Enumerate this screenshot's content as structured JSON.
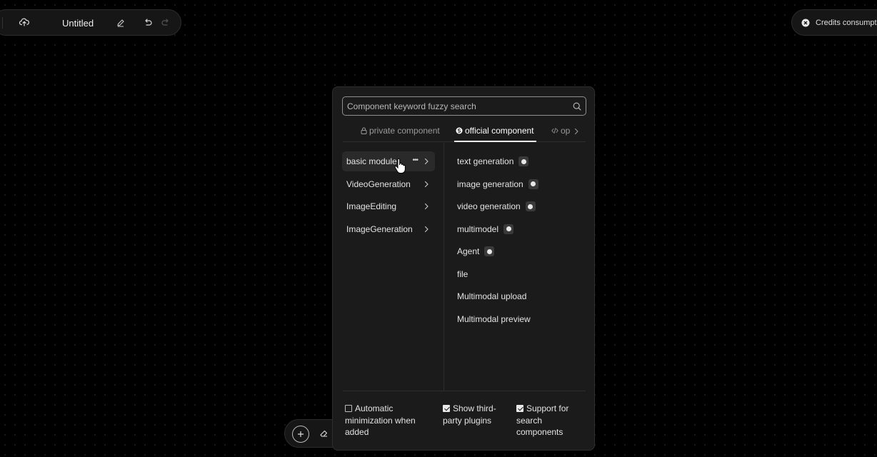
{
  "header": {
    "title": "Untitled",
    "credits_label": "Credits consumption"
  },
  "panel": {
    "search": {
      "placeholder": "Component keyword fuzzy search"
    },
    "tabs": [
      {
        "label": "private component",
        "icon": "lock-icon",
        "active": false
      },
      {
        "label": "official component",
        "icon": "official-badge-icon",
        "active": true
      },
      {
        "label": "op",
        "icon": "code-icon",
        "active": false
      }
    ],
    "categories": [
      {
        "label": "basic module",
        "active": true
      },
      {
        "label": "VideoGeneration",
        "active": false
      },
      {
        "label": "ImageEditing",
        "active": false
      },
      {
        "label": "ImageGeneration",
        "active": false
      }
    ],
    "components": [
      {
        "label": "text generation",
        "badge": true
      },
      {
        "label": "image generation",
        "badge": true
      },
      {
        "label": "video generation",
        "badge": true
      },
      {
        "label": "multimodel",
        "badge": true
      },
      {
        "label": "Agent",
        "badge": true
      },
      {
        "label": "file",
        "badge": false
      },
      {
        "label": "Multimodal upload",
        "badge": false
      },
      {
        "label": "Multimodal preview",
        "badge": false
      }
    ],
    "options": [
      {
        "label": "Automatic minimization when added",
        "checked": false
      },
      {
        "label": "Show third-party plugins",
        "checked": true
      },
      {
        "label": "Support for search components",
        "checked": true
      }
    ]
  },
  "colors": {
    "background": "#000000",
    "panel": "#1b1b1b",
    "accent": "#ffffff"
  }
}
